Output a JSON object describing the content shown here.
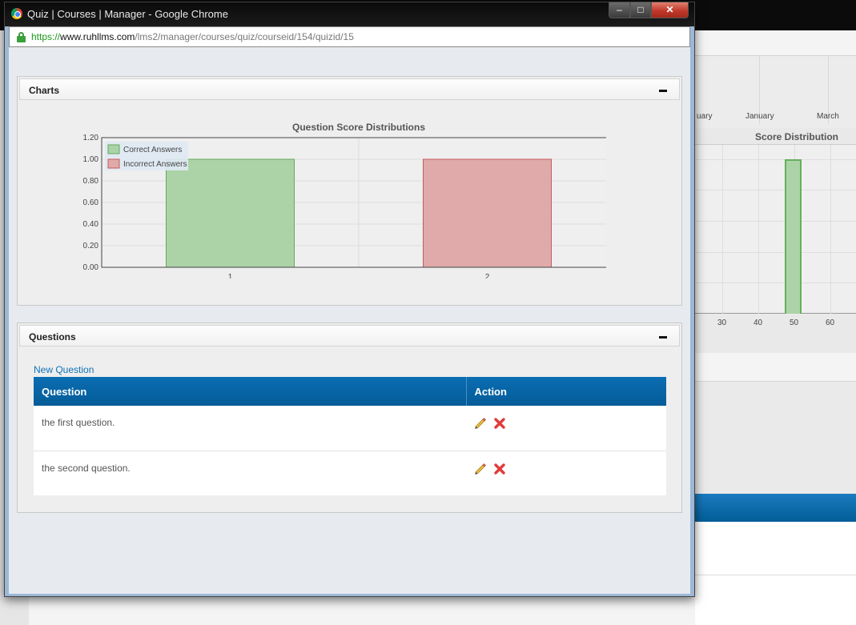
{
  "window": {
    "title": "Quiz | Courses | Manager - Google Chrome",
    "min_label": "–",
    "max_label": "□",
    "close_label": "✕"
  },
  "address": {
    "scheme": "https://",
    "host": "www.ruhllms.com",
    "path": "/lms2/manager/courses/quiz/courseid/154/quizid/15"
  },
  "charts_panel": {
    "title": "Charts"
  },
  "chart_data": {
    "type": "bar",
    "title": "Question Score Distributions",
    "categories": [
      "1",
      "2"
    ],
    "series": [
      {
        "name": "Correct Answers",
        "values": [
          1.0,
          null
        ],
        "color": "#acd3a8",
        "stroke": "#64a85c"
      },
      {
        "name": "Incorrect Answers",
        "values": [
          null,
          1.0
        ],
        "color": "#e0aaaa",
        "stroke": "#c75a5a"
      }
    ],
    "ylim": [
      0,
      1.2
    ],
    "yticks": [
      "0.00",
      "0.20",
      "0.40",
      "0.60",
      "0.80",
      "1.00",
      "1.20"
    ],
    "grid": true,
    "legend": "top-left"
  },
  "questions_panel": {
    "title": "Questions",
    "new_question_label": "New Question",
    "columns": [
      "Question",
      "Action"
    ],
    "rows": [
      {
        "question": "the first question.",
        "actions": [
          "edit-icon",
          "delete-icon"
        ]
      },
      {
        "question": "the second question.",
        "actions": [
          "edit-icon",
          "delete-icon"
        ]
      }
    ]
  },
  "background": {
    "months": [
      "uary",
      "January",
      "March"
    ],
    "score_chart_title": "Score Distribution",
    "xticks": [
      "30",
      "40",
      "50",
      "60"
    ]
  },
  "colors": {
    "header_blue": "#0a6db2",
    "link_blue": "#0f73b8",
    "correct_green": "#acd3a8",
    "incorrect_red": "#e0aaaa"
  }
}
